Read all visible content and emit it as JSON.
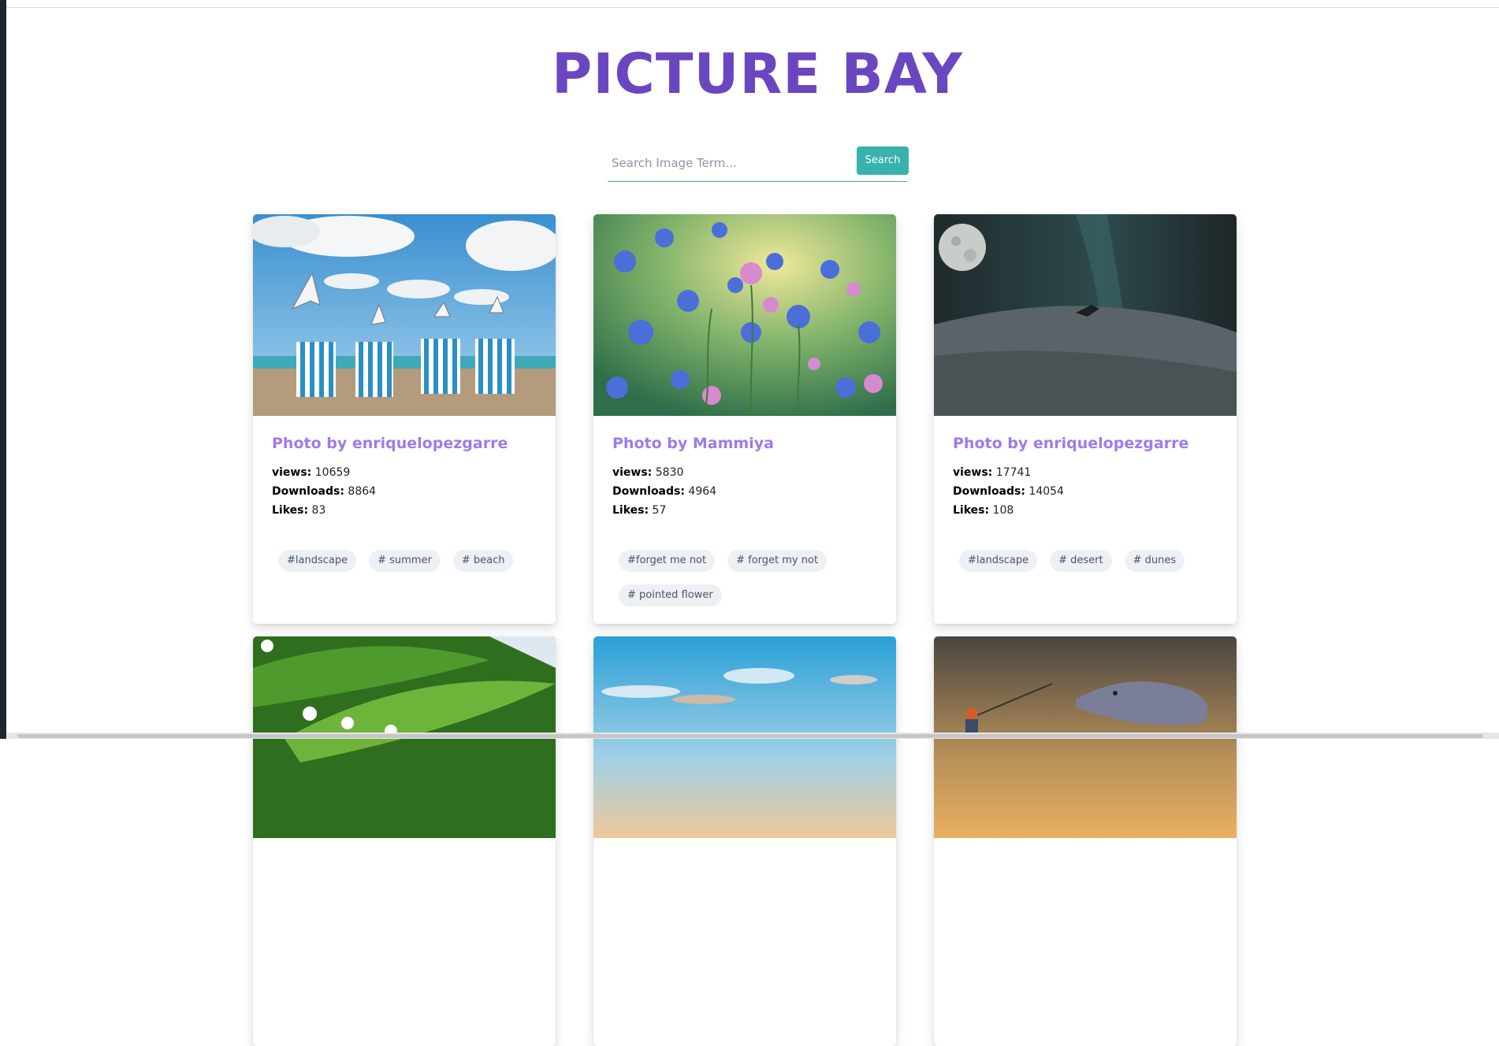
{
  "app": {
    "title": "PICTURE BAY",
    "accent": "#6b46c1",
    "teal": "#38b2ac",
    "author_color": "#9f7aea"
  },
  "search": {
    "placeholder": "Search Image Term...",
    "value": "",
    "button_label": "Search"
  },
  "cards": [
    {
      "author": "Photo by enriquelopezgarre",
      "views_label": "views:",
      "views": "10659",
      "downloads_label": "Downloads:",
      "downloads": "8864",
      "likes_label": "Likes:",
      "likes": "83",
      "tags": [
        "#landscape",
        "# summer",
        "# beach"
      ],
      "image": "beach-chairs-seagulls"
    },
    {
      "author": "Photo by Mammiya",
      "views_label": "views:",
      "views": "5830",
      "downloads_label": "Downloads:",
      "downloads": "4964",
      "likes_label": "Likes:",
      "likes": "57",
      "tags": [
        "#forget me not",
        "# forget my not",
        "# pointed flower"
      ],
      "image": "blue-flowers"
    },
    {
      "author": "Photo by enriquelopezgarre",
      "views_label": "views:",
      "views": "17741",
      "downloads_label": "Downloads:",
      "downloads": "14054",
      "likes_label": "Likes:",
      "likes": "108",
      "tags": [
        "#landscape",
        "# desert",
        "# dunes"
      ],
      "image": "desert-night-moon"
    }
  ],
  "row2_images": [
    "green-leaves-lily",
    "sky-sunset",
    "dolphin-fisherman"
  ]
}
